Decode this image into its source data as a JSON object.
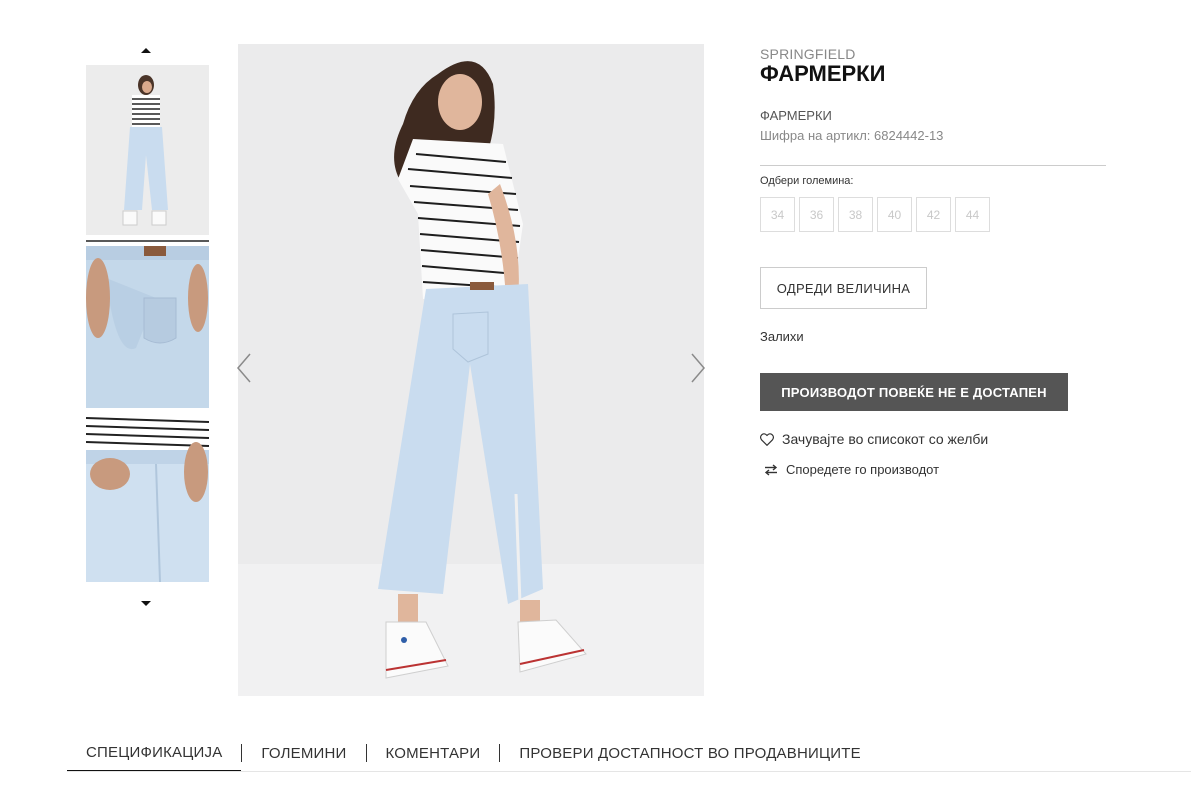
{
  "gallery": {
    "prev_icon": "caret-up-icon",
    "next_icon": "caret-down-icon",
    "thumbnails": [
      "thumbnail-full-back-view",
      "thumbnail-waistband-closeup",
      "thumbnail-front-pocket-closeup"
    ]
  },
  "main_image": {
    "prev_icon": "chevron-left-icon",
    "next_icon": "chevron-right-icon"
  },
  "product": {
    "brand": "SPRINGFIELD",
    "title": "ФАРМЕРКИ",
    "subname": "ФАРМЕРКИ",
    "sku_label": "Шифра на артикл:",
    "sku_value": "6824442-13",
    "size_label": "Одбери големина:",
    "sizes": [
      "34",
      "36",
      "38",
      "40",
      "42",
      "44"
    ],
    "size_guide_label": "ОДРЕДИ ВЕЛИЧИНА",
    "stock_label": "Залихи",
    "unavailable_label": "ПРОИЗВОДОТ ПОВЕЌЕ НЕ Е ДОСТАПЕН",
    "wishlist_label": "Зачувајте во списокот со желби",
    "compare_label": "Споредете го производот"
  },
  "tabs": [
    {
      "label": "СПЕЦИФИКАЦИЈА",
      "active": true
    },
    {
      "label": "ГОЛЕМИНИ",
      "active": false
    },
    {
      "label": "КОМЕНТАРИ",
      "active": false
    },
    {
      "label": "ПРОВЕРИ ДОСТАПНОСТ ВО ПРОДАВНИЦИТЕ",
      "active": false
    }
  ],
  "colors": {
    "button_bg": "#555555",
    "denim": "#c9dcef",
    "text": "#333333"
  }
}
